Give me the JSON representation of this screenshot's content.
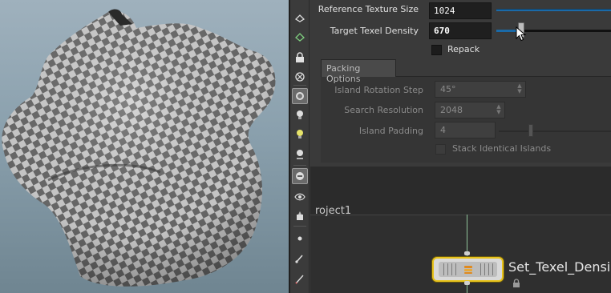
{
  "parameters": {
    "reference_texture_size": {
      "label": "Reference Texture Size",
      "value": "1024"
    },
    "target_texel_density": {
      "label": "Target Texel Density",
      "value": "670",
      "slider_fraction": 0.22
    },
    "repack": {
      "label": "Repack",
      "checked": false
    }
  },
  "packing_options": {
    "tab_label": "Packing Options",
    "island_rotation_step": {
      "label": "Island Rotation Step",
      "value": "45°"
    },
    "search_resolution": {
      "label": "Search Resolution",
      "value": "2048"
    },
    "island_padding": {
      "label": "Island Padding",
      "value": "4"
    },
    "stack_identical_islands": {
      "label": "Stack Identical Islands",
      "checked": false
    }
  },
  "network": {
    "partial_node_label": "roject1",
    "node_name": "Set_Texel_Densi"
  },
  "colors": {
    "slider_fill": "#1a6aa8",
    "node_highlight": "#e7c21a",
    "wire": "#8fc39a"
  },
  "icons": {
    "toolbar": [
      "handle-tool-icon",
      "view-tool-icon",
      "lock-icon",
      "select-icon",
      "display-options-icon",
      "light-icon",
      "camera-light-icon",
      "bone-icon",
      "render-icon",
      "visibility-icon",
      "paint-icon",
      "dot-icon",
      "brush-icon",
      "pen-icon"
    ]
  }
}
